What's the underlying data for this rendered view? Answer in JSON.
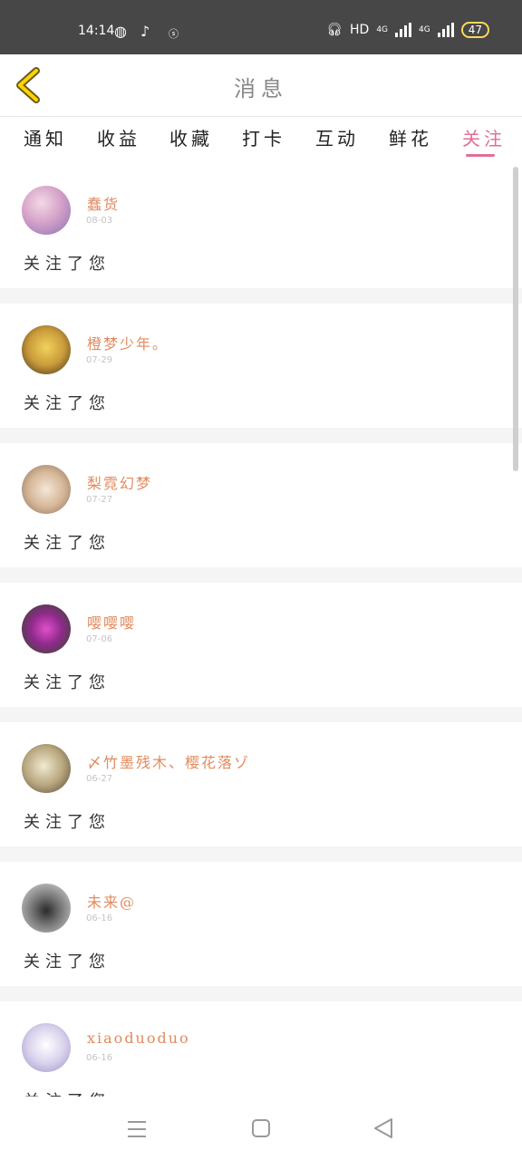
{
  "status_bar": {
    "time": "14:14",
    "network_label": "HD",
    "signal_1": "4G",
    "signal_2": "4G",
    "battery": "47"
  },
  "header": {
    "title": "消息"
  },
  "tabs": [
    {
      "label": "通知"
    },
    {
      "label": "收益"
    },
    {
      "label": "收藏"
    },
    {
      "label": "打卡"
    },
    {
      "label": "互动"
    },
    {
      "label": "鲜花"
    },
    {
      "label": "关注"
    }
  ],
  "active_tab": "关注",
  "notifications": [
    {
      "name": "蠢货",
      "date": "08-03",
      "message": "关注了您"
    },
    {
      "name": "橙梦少年。",
      "date": "07-29",
      "message": "关注了您"
    },
    {
      "name": "梨霓幻梦",
      "date": "07-27",
      "message": "关注了您"
    },
    {
      "name": "嘤嘤嘤",
      "date": "07-06",
      "message": "关注了您"
    },
    {
      "name": "〆竹墨残木、樱花落ゾ",
      "date": "06-27",
      "message": "关注了您"
    },
    {
      "name": "未来@",
      "date": "06-16",
      "message": "关注了您"
    },
    {
      "name": "xiaoduoduo",
      "date": "06-16",
      "message": "关注了您"
    }
  ],
  "colors": {
    "accent": "#e26e95",
    "name": "#e08b5f",
    "status_bar": "#474747",
    "back_arrow": "#ffd400"
  }
}
